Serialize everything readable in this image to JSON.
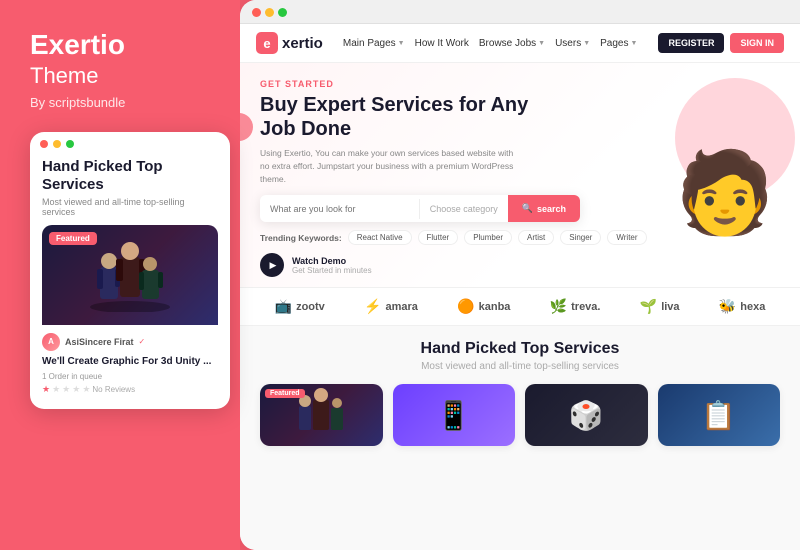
{
  "brand": {
    "title": "Exertio",
    "subtitle": "Theme",
    "by": "By scriptsbundle"
  },
  "mobile_mockup": {
    "heading": "Hand Picked Top Services",
    "subtext": "Most viewed and all-time top-selling services",
    "featured_badge": "Featured",
    "seller_name": "AsiSincere Firat",
    "card_title": "We'll Create Graphic For 3d Unity ...",
    "card_meta": "1 Order in queue",
    "reviews": "No Reviews"
  },
  "browser": {
    "nav": {
      "logo_text": "xertio",
      "links": [
        {
          "label": "Main Pages",
          "has_dropdown": true
        },
        {
          "label": "How It Work",
          "has_dropdown": false
        },
        {
          "label": "Browse Jobs",
          "has_dropdown": true
        },
        {
          "label": "Users",
          "has_dropdown": true
        },
        {
          "label": "Pages",
          "has_dropdown": true
        }
      ],
      "btn_register": "REGISTER",
      "btn_signin": "SIGN IN"
    },
    "hero": {
      "get_started": "GET STARTED",
      "title": "Buy Expert Services for Any Job Done",
      "desc": "Using Exertio, You can make your own services based website with no extra effort. Jumpstart your business with a premium WordPress theme.",
      "search_placeholder": "What are you look for",
      "category_placeholder": "Choose category",
      "search_btn": "search",
      "trending_label": "Trending Keywords:",
      "trending_tags": [
        "React Native",
        "Flutter",
        "Plumber",
        "Artist",
        "Singer",
        "Writer"
      ],
      "watch_demo": "Watch Demo",
      "watch_sub": "Get Started in minutes"
    },
    "partners": [
      {
        "icon": "📺",
        "name": "zoo",
        "suffix": "tv"
      },
      {
        "icon": "⚡",
        "name": "amara"
      },
      {
        "icon": "🟠",
        "name": "kanba"
      },
      {
        "icon": "🌿",
        "name": "treva."
      },
      {
        "icon": "🌱",
        "name": "liva"
      },
      {
        "icon": "🐝",
        "name": "hexa"
      }
    ],
    "hand_picked": {
      "title": "Hand Picked Top Services",
      "subtitle": "Most viewed and all-time top-selling services",
      "cards": [
        {
          "type": "fantasy",
          "featured": true
        },
        {
          "type": "purple",
          "featured": false
        },
        {
          "type": "dark",
          "featured": false
        },
        {
          "type": "blue",
          "featured": false
        }
      ]
    }
  }
}
